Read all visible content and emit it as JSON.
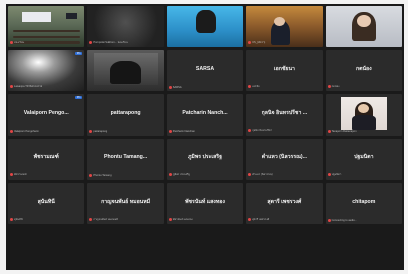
{
  "participants": [
    {
      "kind": "video",
      "scene": "classroom",
      "caption": "ห้องเรียน"
    },
    {
      "kind": "video",
      "scene": "dark",
      "caption": "Pornpolat Sukhom... ห้องเรียน"
    },
    {
      "kind": "video",
      "scene": "sky",
      "caption": ""
    },
    {
      "kind": "video",
      "scene": "room",
      "caption": "CS_(พัชรา)"
    },
    {
      "kind": "video",
      "scene": "woman",
      "caption": ""
    },
    {
      "kind": "video",
      "scene": "blur",
      "caption": "Lawanpa TR Bell ดอกไม้",
      "badge": "Pin"
    },
    {
      "kind": "video",
      "scene": "hands",
      "caption": ""
    },
    {
      "kind": "name",
      "name": "SARSA",
      "caption": "SARSA"
    },
    {
      "kind": "name",
      "name": "เอกชัยนา",
      "caption": "เอกชัย"
    },
    {
      "kind": "name",
      "name": "กตน้อง",
      "caption": "กตน้อง"
    },
    {
      "kind": "name",
      "name": "Valaiporn Pengo...",
      "caption": "Valaiporn Pengoharm",
      "badge": "Pin"
    },
    {
      "kind": "name",
      "name": "pattarapong",
      "caption": "pattarapong"
    },
    {
      "kind": "name",
      "name": "Patcharin Nanch...",
      "caption": "Patcharin Nanchan"
    },
    {
      "kind": "name",
      "name": "กุลนิจ อินทรปรีชา ...",
      "caption": "กุลนิจ อินทรปรีชา"
    },
    {
      "kind": "video",
      "scene": "teacher",
      "caption": "Tanaporn Rattanapon"
    },
    {
      "kind": "name",
      "name": "พัชรามณฑ์",
      "caption": "พัชรามณฑ์"
    },
    {
      "kind": "name",
      "name": "Phontu Tamang...",
      "caption": "Phontu Tamang"
    },
    {
      "kind": "name",
      "name": "ภูมิพร ประเสริฐ",
      "caption": "ภูมิพร ประเสริฐ"
    },
    {
      "kind": "name",
      "name": "ดำแหว (นิลวรรณ)...",
      "caption": "ดำแหว (นิลวรรณ)"
    },
    {
      "kind": "name",
      "name": "ปฐมนิดา",
      "caption": "ปฐมนิดา"
    },
    {
      "kind": "name",
      "name": "สุนันทินี",
      "caption": "สุนันทินี"
    },
    {
      "kind": "name",
      "name": "กาญจนพันธ์ หมอนหมี",
      "caption": "กาญจนพันธ์ หมอนหมี"
    },
    {
      "kind": "name",
      "name": "พัชรนันท์ แสงทอง",
      "caption": "พัชรนันท์ แสงทอง"
    },
    {
      "kind": "name",
      "name": "สุดารี เพชรวงศ์",
      "caption": "สุดารี เพชรวงศ์"
    },
    {
      "kind": "name",
      "name": "chitapom",
      "caption": "Connecting to audio..."
    }
  ]
}
